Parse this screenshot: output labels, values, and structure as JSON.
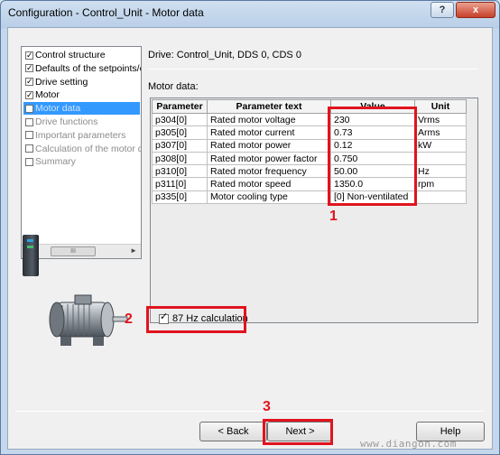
{
  "window": {
    "title": "Configuration - Control_Unit - Motor data",
    "help_icon": "?",
    "close_icon": "x"
  },
  "sidebar": {
    "items": [
      {
        "label": "Control structure",
        "checked": true,
        "state": "normal"
      },
      {
        "label": "Defaults of the setpoints/c",
        "checked": true,
        "state": "normal"
      },
      {
        "label": "Drive setting",
        "checked": true,
        "state": "normal"
      },
      {
        "label": "Motor",
        "checked": true,
        "state": "normal"
      },
      {
        "label": "Motor data",
        "checked": false,
        "state": "selected"
      },
      {
        "label": "Drive functions",
        "checked": false,
        "state": "gray"
      },
      {
        "label": "Important parameters",
        "checked": false,
        "state": "gray"
      },
      {
        "label": "Calculation of the motor d",
        "checked": false,
        "state": "gray"
      },
      {
        "label": "Summary",
        "checked": false,
        "state": "gray"
      }
    ],
    "scroll_thumb": "III",
    "scroll_left_icon": "◄",
    "scroll_right_icon": "►"
  },
  "drive_info": "Drive: Control_Unit, DDS 0, CDS 0",
  "motor_data_label": "Motor data:",
  "table": {
    "headers": [
      "Parameter",
      "Parameter text",
      "Value",
      "Unit"
    ],
    "rows": [
      [
        "p304[0]",
        "Rated motor voltage",
        "230",
        "Vrms"
      ],
      [
        "p305[0]",
        "Rated motor current",
        "0.73",
        "Arms"
      ],
      [
        "p307[0]",
        "Rated motor power",
        "0.12",
        "kW"
      ],
      [
        "p308[0]",
        "Rated motor power factor",
        "0.750",
        ""
      ],
      [
        "p310[0]",
        "Rated motor frequency",
        "50.00",
        "Hz"
      ],
      [
        "p311[0]",
        "Rated motor speed",
        "1350.0",
        "rpm"
      ],
      [
        "p335[0]",
        "Motor cooling type",
        "[0] Non-ventilated",
        ""
      ]
    ]
  },
  "hz87": {
    "label": "87 Hz calculation",
    "checked": true
  },
  "annotations": {
    "one": "1",
    "two": "2",
    "three": "3",
    "color": "#e0141e"
  },
  "buttons": {
    "back": "< Back",
    "next": "Next >",
    "help": "Help"
  },
  "watermark": "www.diangon.com"
}
